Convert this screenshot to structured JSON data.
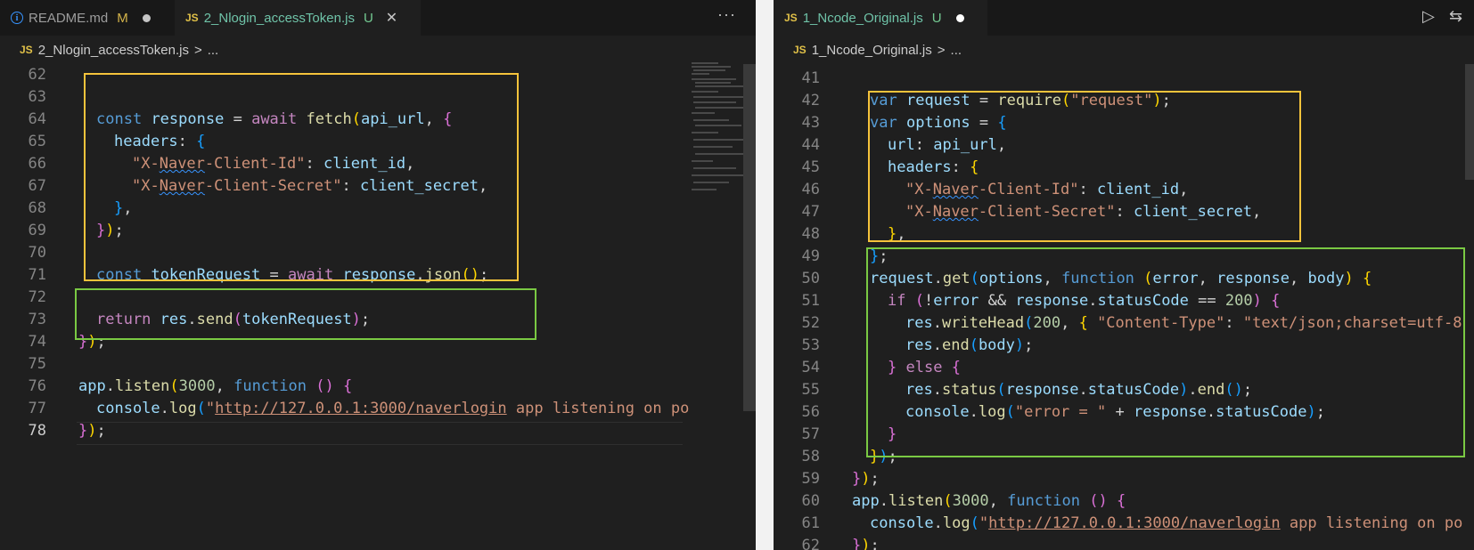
{
  "left": {
    "tabs": [
      {
        "label": "README.md",
        "status": "M",
        "icon": "info-icon"
      },
      {
        "label": "2_Nlogin_accessToken.js",
        "status": "U",
        "icon": "js-icon"
      }
    ],
    "more_label": "···",
    "breadcrumb": {
      "file": "2_Nlogin_accessToken.js",
      "sep": ">",
      "rest": "..."
    },
    "line_numbers": [
      "62",
      "63",
      "64",
      "65",
      "66",
      "67",
      "68",
      "69",
      "70",
      "71",
      "72",
      "73",
      "74",
      "75",
      "76",
      "77",
      "78"
    ]
  },
  "right": {
    "tabs": [
      {
        "label": "1_Ncode_Original.js",
        "status": "U",
        "icon": "js-icon"
      }
    ],
    "breadcrumb": {
      "file": "1_Ncode_Original.js",
      "sep": ">",
      "rest": "..."
    },
    "line_numbers": [
      "41",
      "42",
      "43",
      "44",
      "45",
      "46",
      "47",
      "48",
      "49",
      "50",
      "51",
      "52",
      "53",
      "54",
      "55",
      "56",
      "57",
      "58",
      "59",
      "60",
      "61",
      "62"
    ]
  },
  "icons": {
    "js": "JS",
    "run": "▷",
    "compare": "⇆"
  },
  "colors": {
    "highlight_yellow": "#f5c33b",
    "highlight_green": "#7ac943",
    "editor_bg": "#1f1f1f"
  }
}
